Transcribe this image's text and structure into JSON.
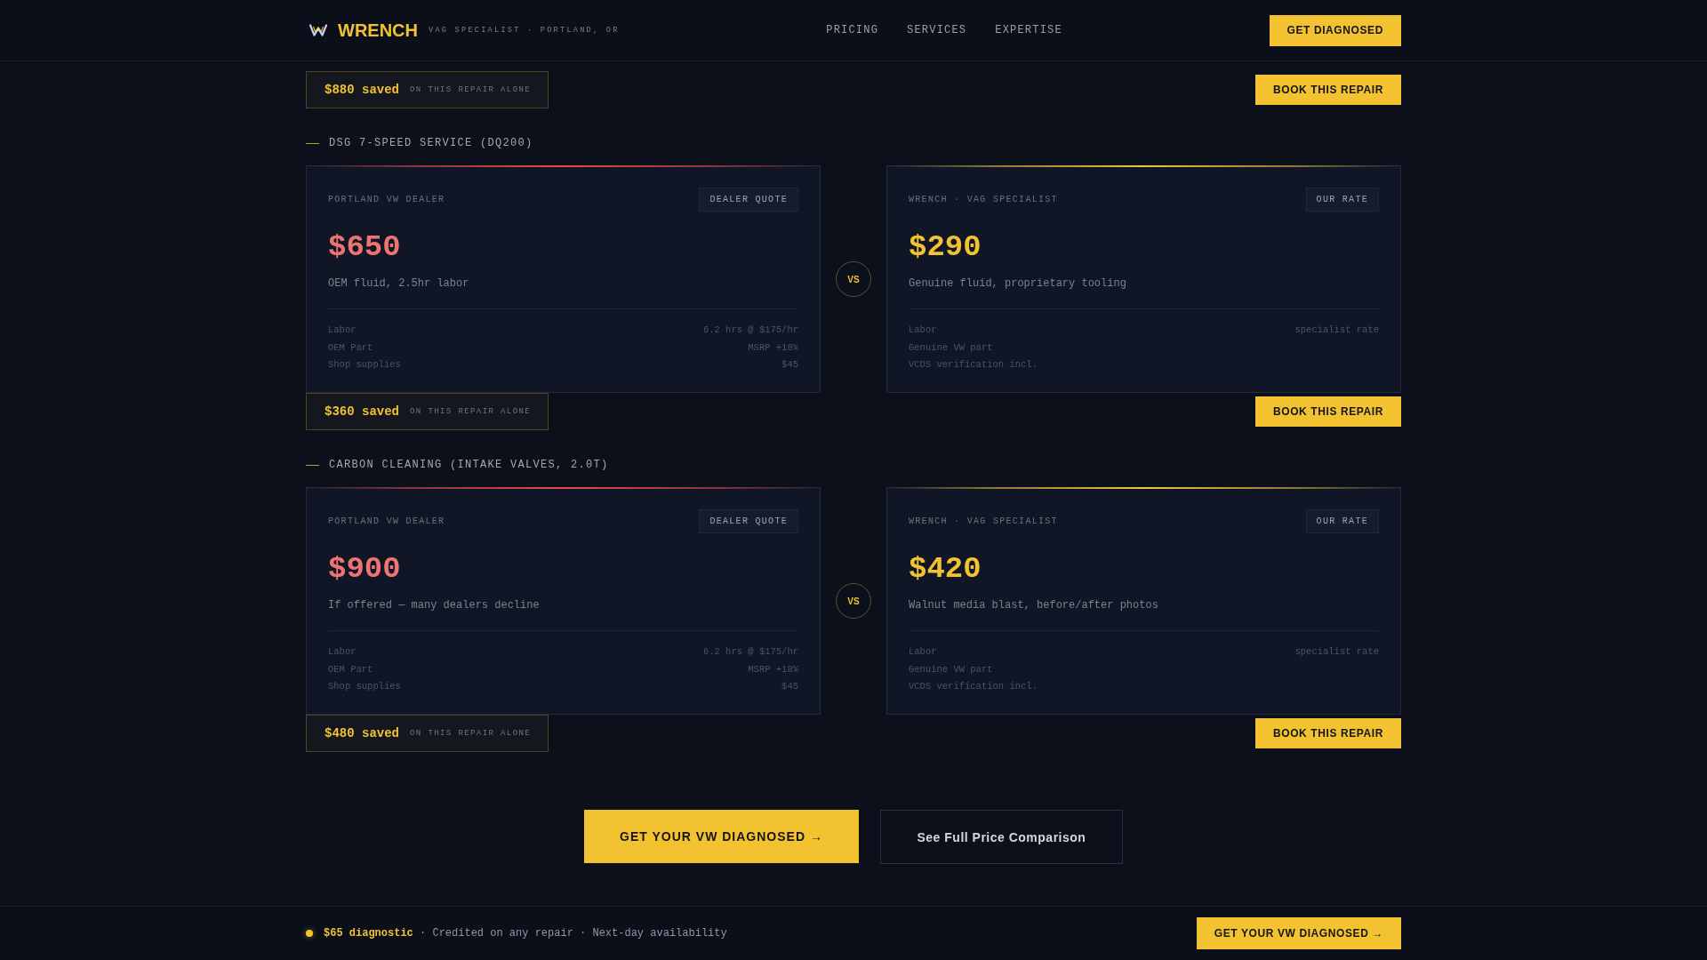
{
  "header": {
    "brand": "WRENCH",
    "tagline": "VAG SPECIALIST · PORTLAND, OR",
    "nav": [
      "PRICING",
      "SERVICES",
      "EXPERTISE"
    ],
    "button": "GET DIAGNOSED"
  },
  "previous_savings": {
    "amount": "$880 saved",
    "note": "ON THIS REPAIR ALONE",
    "button": "BOOK THIS REPAIR"
  },
  "comparisons": [
    {
      "title": "DSG 7-SPEED SERVICE (DQ200)",
      "vs": "VS",
      "quotes": [
        {
          "kind": "dealer",
          "source": "PORTLAND VW DEALER",
          "badge": "DEALER QUOTE",
          "price": "$650",
          "description": "OEM fluid, 2.5hr labor",
          "lines": [
            {
              "label": "Labor",
              "value": "6.2 hrs @ $175/hr"
            },
            {
              "label": "OEM Part",
              "value": "MSRP +18%"
            },
            {
              "label": "Shop supplies",
              "value": "$45"
            }
          ]
        },
        {
          "kind": "specialist",
          "source": "WRENCH · VAG SPECIALIST",
          "badge": "OUR RATE",
          "price": "$290",
          "description": "Genuine fluid, proprietary tooling",
          "lines": [
            {
              "label": "Labor",
              "value": "specialist rate"
            },
            {
              "label": "Genuine VW part"
            },
            {
              "label": "VCDS verification incl."
            }
          ]
        }
      ],
      "savings": {
        "amount": "$360 saved",
        "note": "ON THIS REPAIR ALONE",
        "button": "BOOK THIS REPAIR"
      }
    },
    {
      "title": "CARBON CLEANING (INTAKE VALVES, 2.0T)",
      "vs": "VS",
      "quotes": [
        {
          "kind": "dealer",
          "source": "PORTLAND VW DEALER",
          "badge": "DEALER QUOTE",
          "price": "$900",
          "description": "If offered — many dealers decline",
          "lines": [
            {
              "label": "Labor",
              "value": "6.2 hrs @ $175/hr"
            },
            {
              "label": "OEM Part",
              "value": "MSRP +18%"
            },
            {
              "label": "Shop supplies",
              "value": "$45"
            }
          ]
        },
        {
          "kind": "specialist",
          "source": "WRENCH · VAG SPECIALIST",
          "badge": "OUR RATE",
          "price": "$420",
          "description": "Walnut media blast, before/after photos",
          "lines": [
            {
              "label": "Labor",
              "value": "specialist rate"
            },
            {
              "label": "Genuine VW part"
            },
            {
              "label": "VCDS verification incl."
            }
          ]
        }
      ],
      "savings": {
        "amount": "$480 saved",
        "note": "ON THIS REPAIR ALONE",
        "button": "BOOK THIS REPAIR"
      }
    }
  ],
  "cta": {
    "primary": "GET YOUR VW DIAGNOSED →",
    "secondary": "See Full Price Comparison"
  },
  "sticky_bar": {
    "text": "**$65 diagnostic** · Credited on any repair · Next-day availability",
    "button": "GET YOUR VW DIAGNOSED →"
  }
}
